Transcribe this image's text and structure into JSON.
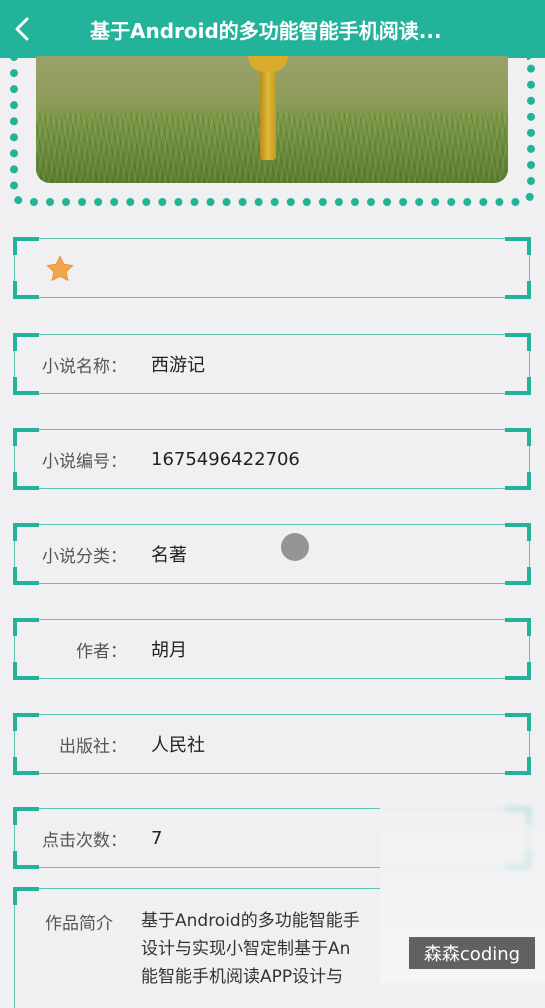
{
  "header": {
    "title": "基于Android的多功能智能手机阅读...",
    "back_icon": "chevron-left-icon"
  },
  "favorite": {
    "icon": "star-icon",
    "color": "#f0a64a"
  },
  "fields": [
    {
      "label": "小说名称：",
      "value": "西游记"
    },
    {
      "label": "小说编号：",
      "value": "1675496422706"
    },
    {
      "label": "小说分类：",
      "value": "名著"
    },
    {
      "label": "作者：",
      "value": "胡月"
    },
    {
      "label": "出版社：",
      "value": "人民社"
    },
    {
      "label": "点击次数：",
      "value": "7"
    }
  ],
  "intro": {
    "label": "作品简介",
    "lines": [
      "基于Android的多功能智能手",
      "设计与实现小智定制基于An",
      "能智能手机阅读APP设计与"
    ]
  },
  "watermark": "森森coding",
  "colors": {
    "accent": "#22b39a",
    "background": "#f0f0f2"
  }
}
